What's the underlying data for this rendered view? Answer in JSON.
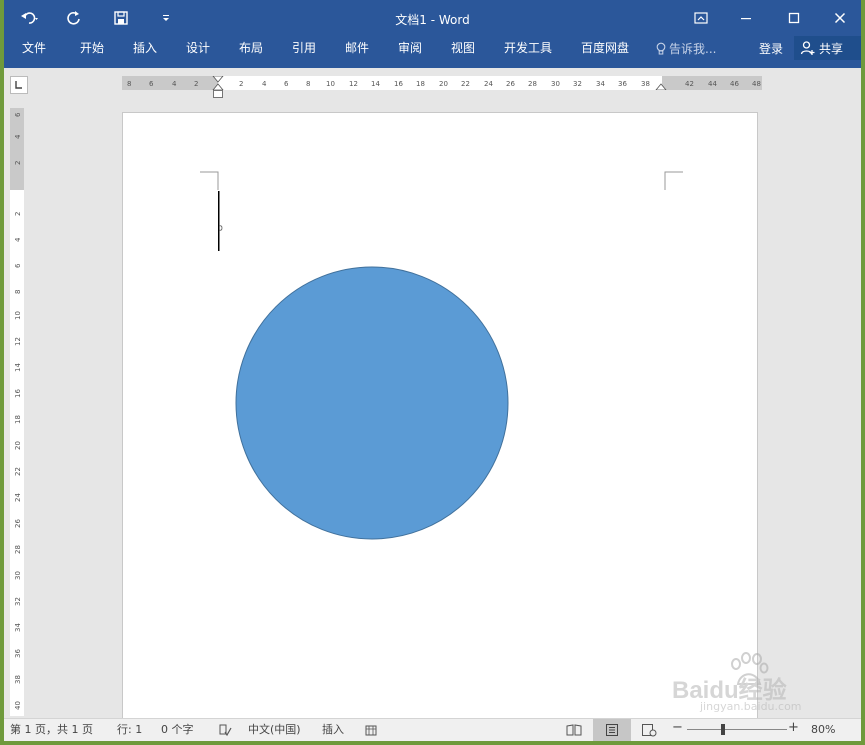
{
  "window": {
    "title": "文档1 - Word"
  },
  "quick_access": {
    "undo_icon": "undo-icon",
    "redo_icon": "redo-icon",
    "save_icon": "save-icon",
    "customize_icon": "customize-icon"
  },
  "tabs": [
    "文件",
    "开始",
    "插入",
    "设计",
    "布局",
    "引用",
    "邮件",
    "审阅",
    "视图",
    "开发工具",
    "百度网盘"
  ],
  "tell_me": "告诉我...",
  "sign_in": "登录",
  "share": "共享",
  "hruler": {
    "left_ticks": [
      "8",
      "6",
      "4",
      "2"
    ],
    "right_ticks": [
      "2",
      "4",
      "6",
      "8",
      "10",
      "12",
      "14",
      "16",
      "18",
      "20",
      "22",
      "24",
      "26",
      "28",
      "30",
      "32",
      "34",
      "36",
      "38",
      "42",
      "44",
      "46",
      "48"
    ]
  },
  "vruler": {
    "top_ticks": [
      "6",
      "4",
      "2"
    ],
    "ticks": [
      "2",
      "4",
      "6",
      "8",
      "10",
      "12",
      "14",
      "16",
      "18",
      "20",
      "22",
      "24",
      "26",
      "28",
      "30",
      "32",
      "34",
      "36",
      "38",
      "40"
    ]
  },
  "shape": {
    "type": "circle",
    "fill": "#5b9bd5",
    "stroke": "#41719c"
  },
  "status": {
    "page": "第 1 页，共 1 页",
    "line": "行: 1",
    "words": "0 个字",
    "language": "中文(中国)",
    "mode": "插入",
    "zoom": "80%"
  },
  "watermark": {
    "brand": "Baidu经验",
    "url": "jingyan.baidu.com"
  },
  "colors": {
    "accent": "#2b579a",
    "canvas": "#e6e6e6",
    "page": "#ffffff",
    "ruler_shade": "#c9c9c9"
  }
}
